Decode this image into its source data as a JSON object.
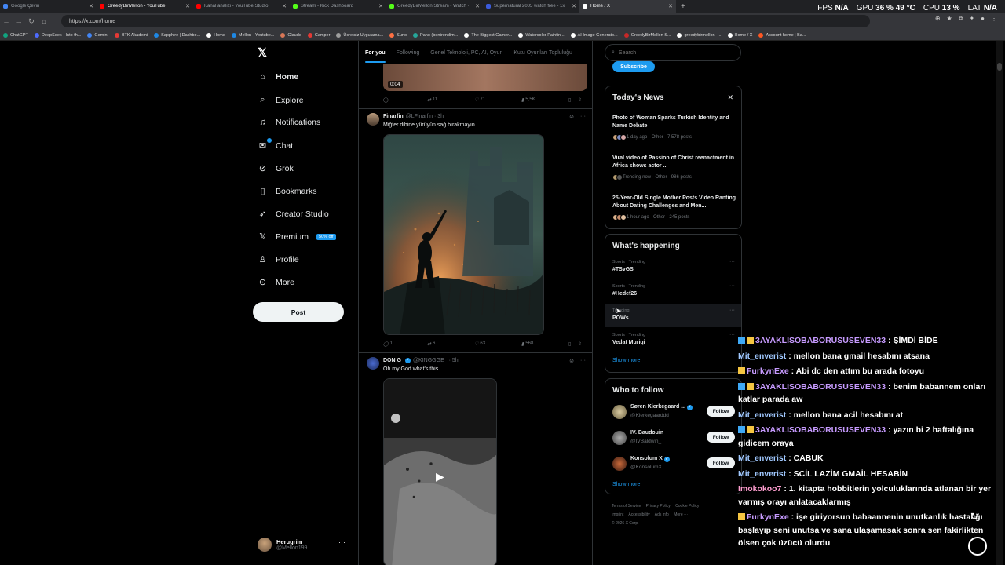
{
  "browser": {
    "tabs": [
      {
        "label": "Google Çeviri",
        "color": "#4285f4",
        "active": false
      },
      {
        "label": "GreedyBirMellon - YouTube",
        "color": "#ff0000",
        "active": false
      },
      {
        "label": "Kanal analizi - YouTube Studio",
        "color": "#ff0000",
        "active": false
      },
      {
        "label": "Stream - Kick Dashboard",
        "color": "#53fc18",
        "active": false
      },
      {
        "label": "GreedyBirMellon Stream - Watch ·",
        "color": "#53fc18",
        "active": false
      },
      {
        "label": "Supernatural 2005 watch free - 1x",
        "color": "#3b5bdb",
        "active": false
      },
      {
        "label": "Home / X",
        "color": "#ffffff",
        "active": true
      }
    ],
    "url": "https://x.com/home",
    "bookmarks": [
      "ChatGPT",
      "DeepSeek - Into th...",
      "Gemini",
      "BTK Akademi",
      "Sapphire | Dashbo...",
      "Home",
      "Mellon - Youtube...",
      "Claude",
      "Camper",
      "Ücretsiz Uygulama...",
      "Suno",
      "Pano (bentrendim...",
      "The Biggest Gamer...",
      "Watercolor Paintin...",
      "AI Image Generato...",
      "GreedyBirMellon S...",
      "greedybirmellon -...",
      "Home / X",
      "Account home | Ba..."
    ],
    "bookmark_colors": [
      "#10a37f",
      "#4d6bfe",
      "#4285f4",
      "#e53935",
      "#1e88e5",
      "#fff",
      "#1e88e5",
      "#d97757",
      "#e53935",
      "#9e9e9e",
      "#ff7043",
      "#26a69a",
      "#fff",
      "#fff",
      "#fff",
      "#c62828",
      "#fff",
      "#fff",
      "#ff5722"
    ]
  },
  "sysmon": {
    "fps_label": "FPS",
    "fps": "N/A",
    "gpu_label": "GPU",
    "gpu": "36 % 49 °C",
    "cpu_label": "CPU",
    "cpu": "13 %",
    "lat_label": "LAT",
    "lat": "N/A"
  },
  "nav": {
    "home": "Home",
    "explore": "Explore",
    "notifications": "Notifications",
    "chat": "Chat",
    "grok": "Grok",
    "bookmarks": "Bookmarks",
    "creator_studio": "Creator Studio",
    "premium": "Premium",
    "premium_badge": "50% off",
    "profile": "Profile",
    "more": "More",
    "post": "Post"
  },
  "account": {
    "name": "Herugrim",
    "handle": "@Mellon199"
  },
  "feed": {
    "tabs": [
      "For you",
      "Following",
      "Genel Teknoloji, PC, AI, Oyun",
      "Kutu Oyunları Topluluğu"
    ],
    "tweet0": {
      "duration": "0:04",
      "replies": "",
      "reposts": "11",
      "likes": "71",
      "views": "5,5K"
    },
    "tweet1": {
      "name": "Finarfin",
      "handle": "@LFinarfin · 3h",
      "text": "Miğfer dibine yürüyün sağ bırakmayın",
      "replies": "1",
      "reposts": "6",
      "likes": "63",
      "views": "568"
    },
    "tweet2": {
      "name": "DON G",
      "handle": "@KINGGGE_ · 5h",
      "text": "Oh my God what's this"
    }
  },
  "right": {
    "search_placeholder": "Search",
    "subscribe": "Subscribe",
    "news_title": "Today's News",
    "news": [
      {
        "title": "Photo of Woman Sparks Turkish Identity and Name Debate",
        "meta": "1 day ago · Other · 7,578 posts"
      },
      {
        "title": "Viral video of Passion of Christ reenactment in Africa shows actor ...",
        "meta": "Trending now · Other · 986 posts"
      },
      {
        "title": "25-Year-Old Single Mother Posts Video Ranting About Dating Challenges and Men...",
        "meta": "1 hour ago · Other · 245 posts"
      }
    ],
    "happening_title": "What's happening",
    "trends": [
      {
        "label": "Sports · Trending",
        "name": "#TSvGS"
      },
      {
        "label": "Sports · Trending",
        "name": "#Hedef26"
      },
      {
        "label": "Trending",
        "name": "POWs"
      },
      {
        "label": "Sports · Trending",
        "name": "Vedat Muriqi"
      }
    ],
    "show_more": "Show more",
    "follow_title": "Who to follow",
    "follow": [
      {
        "name": "Søren Kierkegaard ...",
        "handle": "@Kierkegaarddd",
        "btn": "Follow",
        "color": "#c2b28a"
      },
      {
        "name": "IV. Baudouin",
        "handle": "@IVBaldwin_",
        "btn": "Follow",
        "color": "#888"
      },
      {
        "name": "Konsolum X",
        "handle": "@KonsolumX",
        "btn": "Follow",
        "color": "#a0522d"
      }
    ],
    "footer": [
      "Terms of Service",
      "Privacy Policy",
      "Cookie Policy",
      "Imprint",
      "Accessibility",
      "Ads info",
      "More ···",
      "© 2026 X Corp."
    ]
  },
  "chat": [
    {
      "user": "3AYAKLISOBABORUSUSEVEN33",
      "text": " : ŞİMDİ BİDE",
      "cls": "purple",
      "icons": 2
    },
    {
      "user": "Mit_enverist",
      "text": " : mellon bana gmail hesabını atsana",
      "cls": "",
      "icons": 0
    },
    {
      "user": "FurkynExe",
      "text": " : Abi dc den attım bu arada fotoyu",
      "cls": "purple",
      "icons": 1
    },
    {
      "user": "3AYAKLISOBABORUSUSEVEN33",
      "text": " : benim babannem onları katlar parada aw",
      "cls": "purple",
      "icons": 2
    },
    {
      "user": "Mit_enverist",
      "text": " : mellon bana acil hesabını at",
      "cls": "",
      "icons": 0
    },
    {
      "user": "3AYAKLISOBABORUSUSEVEN33",
      "text": " : yazın bi 2 haftalığına gidicem oraya",
      "cls": "purple",
      "icons": 2
    },
    {
      "user": "Mit_enverist",
      "text": " : CABUK",
      "cls": "",
      "icons": 0
    },
    {
      "user": "Mit_enverist",
      "text": " : SCİL LAZİM GMAİL HESABİN",
      "cls": "",
      "icons": 0
    },
    {
      "user": "Imokokoo7",
      "text": " : 1. kitapta hobbitlerin yolculuklarında atlanan bir yer varmış orayı anlatacaklarmış",
      "cls": "pink",
      "icons": 0
    },
    {
      "user": "FurkynExe",
      "text": " : işe giriyorsun babaannenin unutkanlık hastalığı başlayıp seni unutsa ve sana ulaşamasak sonra sen fakirlikten ölsen çok üzücü olurdu",
      "cls": "purple",
      "icons": 1
    }
  ]
}
